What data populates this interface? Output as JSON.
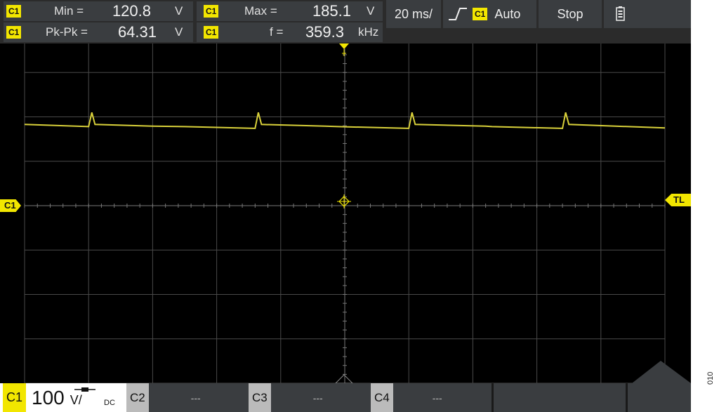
{
  "measurements": [
    {
      "channel": "C1",
      "label": "Min =",
      "value": "120.8",
      "unit": "V"
    },
    {
      "channel": "C1",
      "label": "Max =",
      "value": "185.1",
      "unit": "V"
    },
    {
      "channel": "C1",
      "label": "Pk-Pk =",
      "value": "64.31",
      "unit": "V"
    },
    {
      "channel": "C1",
      "label": "f =",
      "value": "359.3",
      "unit": "kHz"
    }
  ],
  "timebase": "20 ms/",
  "trigger": {
    "channel": "C1",
    "mode": "Auto",
    "slope_icon": "rising-edge-icon"
  },
  "run_button": "Stop",
  "battery_icon": "battery-icon",
  "markers": {
    "channel_offset": "C1",
    "trigger_level": "TL"
  },
  "channels": [
    {
      "name": "C1",
      "scale": "100",
      "unit": "V/",
      "coupling": "DC",
      "active": true
    },
    {
      "name": "C2",
      "scale": "---",
      "active": false
    },
    {
      "name": "C3",
      "scale": "---",
      "active": false
    },
    {
      "name": "C4",
      "scale": "---",
      "active": false
    }
  ],
  "figure_id": "010",
  "colors": {
    "trace": "#d9d13a",
    "channel1": "#f2e600",
    "grid": "#4a4a4a",
    "background": "#000000"
  },
  "chart_data": {
    "type": "line",
    "x": [
      0,
      0.1,
      0.105,
      0.11,
      0.2,
      0.25,
      0.36,
      0.365,
      0.37,
      0.47,
      0.49,
      0.6,
      0.605,
      0.61,
      0.72,
      0.73,
      0.84,
      0.845,
      0.85,
      1.0
    ],
    "values": [
      183,
      178,
      210,
      183,
      179,
      178,
      174,
      210,
      183,
      179,
      178,
      174,
      210,
      183,
      179,
      178,
      174,
      210,
      183,
      175
    ],
    "xlabel": "",
    "ylabel": "",
    "ylim": [
      -400,
      400
    ],
    "grid": true
  }
}
